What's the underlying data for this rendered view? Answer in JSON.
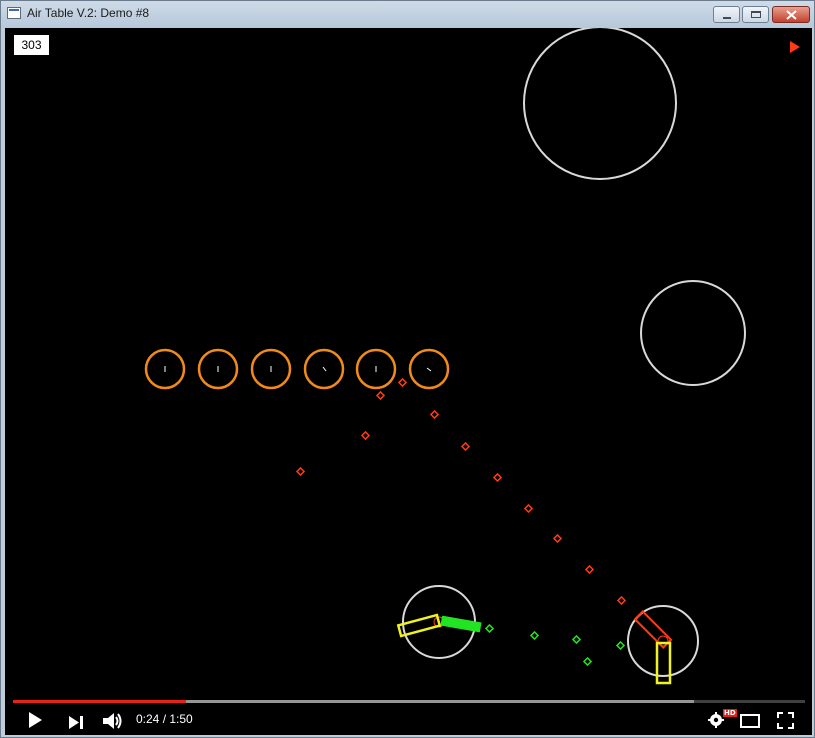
{
  "window": {
    "title": "Air Table V.2: Demo #8"
  },
  "game": {
    "score": "303",
    "background": "#000000",
    "colors": {
      "target_ring": "#f08a1a",
      "dot_red": "#ff3b14",
      "dot_green": "#22e422",
      "obstacle": "#d9d9d9",
      "paddle_yellow": "#f2f21e",
      "paddle_green": "#22e422",
      "paddle_red": "#ff3b14"
    },
    "icons": [
      "play-indicator-icon"
    ]
  },
  "player": {
    "time": "0:24 / 1:50",
    "progress": 0.218,
    "buffered": 0.86,
    "quality_badge": "HD",
    "accent": "#e62117",
    "icons": [
      "play-icon",
      "next-icon",
      "volume-icon",
      "settings-icon",
      "theater-mode-icon",
      "fullscreen-icon"
    ]
  }
}
